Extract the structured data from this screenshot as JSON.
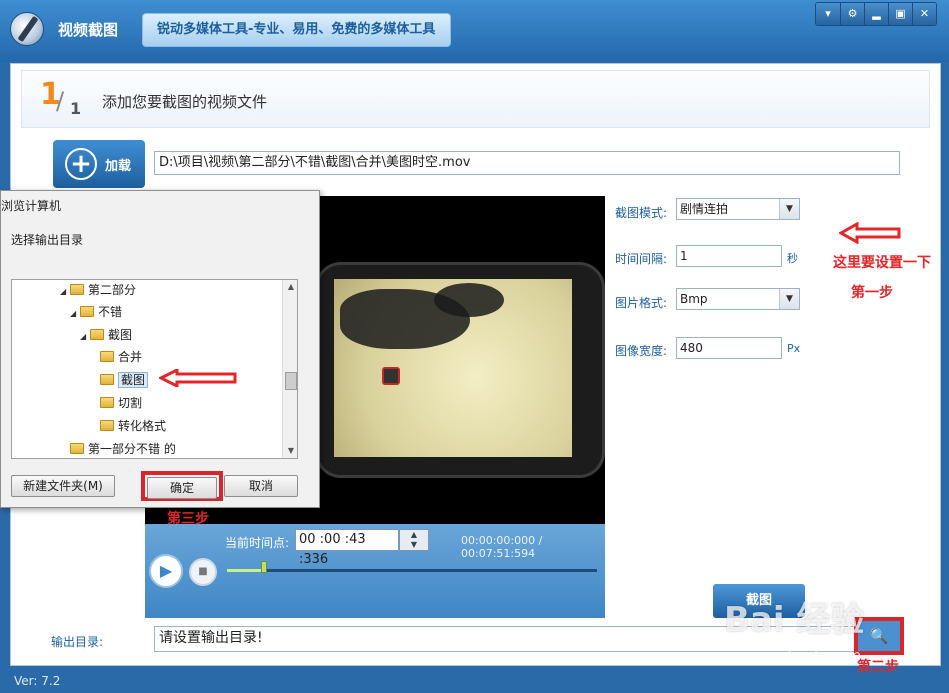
{
  "window": {
    "title": "视频截图",
    "slogan": "锐动多媒体工具-专业、易用、免费的多媒体工具",
    "controls": {
      "menu": "▾",
      "settings": "⚙",
      "minimize": "▂",
      "maximize": "▣",
      "close": "✕"
    }
  },
  "step": {
    "num": "1",
    "slash": "/",
    "den": "1",
    "title": "添加您要截图的视频文件"
  },
  "load": {
    "label": "加载",
    "icon": "+"
  },
  "file_path": "D:\\项目\\视频\\第二部分\\不错\\截图\\合并\\美图时空.mov",
  "player": {
    "current_label": "当前时间点:",
    "current_time": "00 :00 :43 :336",
    "timecode": "00:00:00:000 / 00:07:51:594",
    "play_icon": "▶",
    "stop_icon": "■",
    "progress_fraction": 0.1
  },
  "settings": {
    "mode_label": "截图模式:",
    "mode_value": "剧情连拍",
    "interval_label": "时间间隔:",
    "interval_value": "1",
    "interval_unit": "秒",
    "format_label": "图片格式:",
    "format_value": "Bmp",
    "width_label": "图像宽度:",
    "width_value": "480",
    "width_unit": "Px"
  },
  "snapshot_button": "截图",
  "output": {
    "label": "输出目录:",
    "value": "请设置输出目录!"
  },
  "annotations": {
    "set_here": "这里要设置一下",
    "step1": "第一步",
    "step2": "第二步",
    "step3": "第三步",
    "color": "#e2262a"
  },
  "dialog": {
    "title": "浏览计算机",
    "subtitle": "选择输出目录",
    "tree": [
      {
        "label": "第二部分",
        "expanded": true
      },
      {
        "label": "不错",
        "expanded": true
      },
      {
        "label": "截图",
        "expanded": true
      },
      {
        "label": "合并",
        "expanded": false
      },
      {
        "label": "截图",
        "expanded": false,
        "selected": true
      },
      {
        "label": "切割",
        "expanded": false
      },
      {
        "label": "转化格式",
        "expanded": false
      },
      {
        "label": "第一部分不错 的",
        "expanded": false
      }
    ],
    "new_folder": "新建文件夹(M)",
    "ok": "确定",
    "cancel": "取消"
  },
  "status": {
    "version": "Ver: 7.2"
  },
  "watermark": {
    "main": "Bai 经验",
    "sub": "jingyan.baidu.com"
  }
}
